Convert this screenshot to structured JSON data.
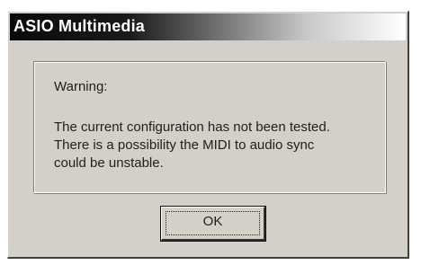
{
  "dialog": {
    "title": "ASIO Multimedia",
    "warning_label": "Warning:",
    "message_lines": [
      "The current configuration has not been tested.",
      "There is a possibility the MIDI to audio sync",
      "could be unstable."
    ],
    "ok_label": "OK"
  }
}
